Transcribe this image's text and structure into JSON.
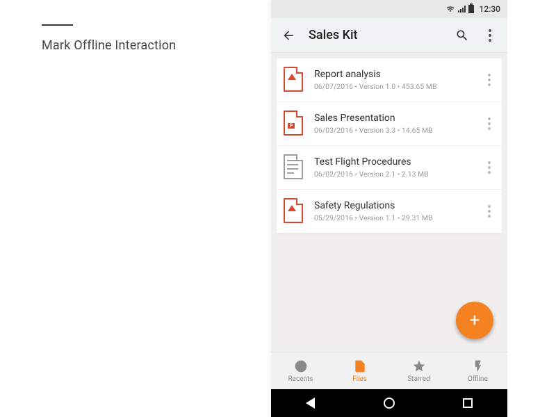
{
  "caption": "Mark Offline Interaction",
  "statusbar": {
    "time": "12:30"
  },
  "appbar": {
    "title": "Sales Kit"
  },
  "files": [
    {
      "name": "Report analysis",
      "meta": "06/07/2016 • Version 1.0 • 453.65 MB",
      "icon": "pdf"
    },
    {
      "name": "Sales Presentation",
      "meta": "06/03/2016 • Version 3.3 • 14.65 MB",
      "icon": "ppt"
    },
    {
      "name": "Test Flight Procedures",
      "meta": "06/02/2016 • Version 2.1 • 2.13 MB",
      "icon": "doc"
    },
    {
      "name": "Safety Regulations",
      "meta": "05/29/2016 • Version 1.1 • 29.31 MB",
      "icon": "pdf"
    }
  ],
  "bottomnav": {
    "items": [
      {
        "label": "Recents",
        "active": false
      },
      {
        "label": "Files",
        "active": true
      },
      {
        "label": "Starred",
        "active": false
      },
      {
        "label": "Offline",
        "active": false
      }
    ]
  },
  "fab": {
    "label": "+"
  }
}
